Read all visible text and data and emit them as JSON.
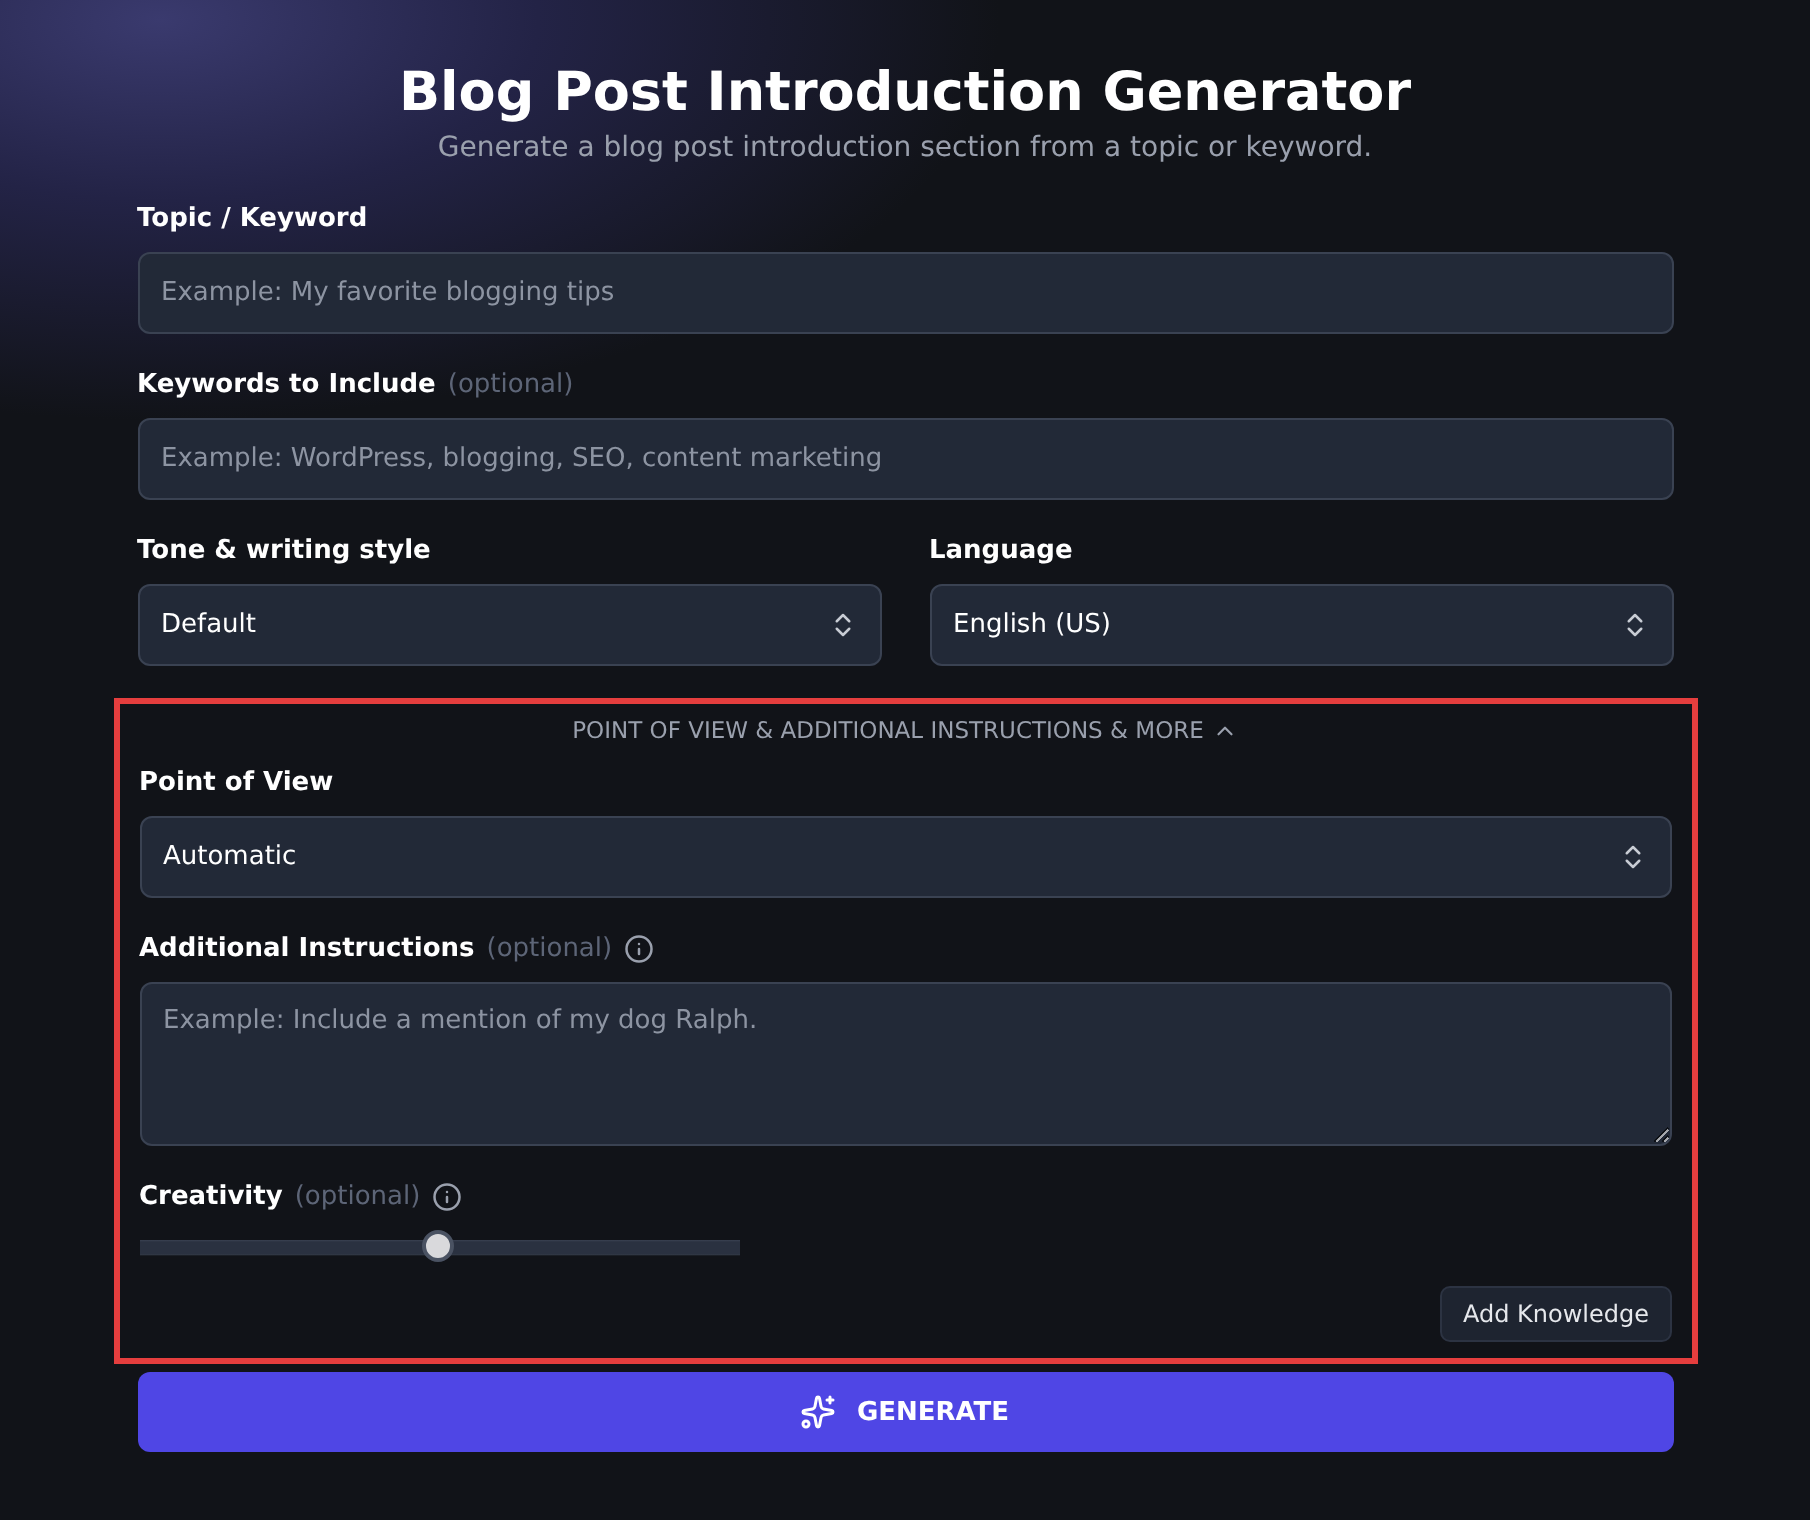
{
  "header": {
    "title": "Blog Post Introduction Generator",
    "subtitle": "Generate a blog post introduction section from a topic or keyword."
  },
  "topic": {
    "label": "Topic / Keyword",
    "placeholder": "Example: My favorite blogging tips"
  },
  "keywords": {
    "label": "Keywords to Include",
    "optional": "(optional)",
    "placeholder": "Example: WordPress, blogging, SEO, content marketing"
  },
  "selects": [
    {
      "label": "Tone & writing style",
      "value": "Default"
    },
    {
      "label": "Language",
      "value": "English (US)"
    }
  ],
  "more": {
    "toggle": "POINT OF VIEW & ADDITIONAL INSTRUCTIONS & MORE",
    "expanded": true,
    "highlighted": true,
    "point_of_view": {
      "label": "Point of View",
      "value": "Automatic"
    },
    "instructions": {
      "label": "Additional Instructions",
      "optional": "(optional)",
      "placeholder": "Example: Include a mention of my dog Ralph."
    },
    "creativity": {
      "label": "Creativity",
      "optional": "(optional)",
      "level": 0.5
    },
    "add_knowledge": "Add Knowledge"
  },
  "generate": "GENERATE"
}
